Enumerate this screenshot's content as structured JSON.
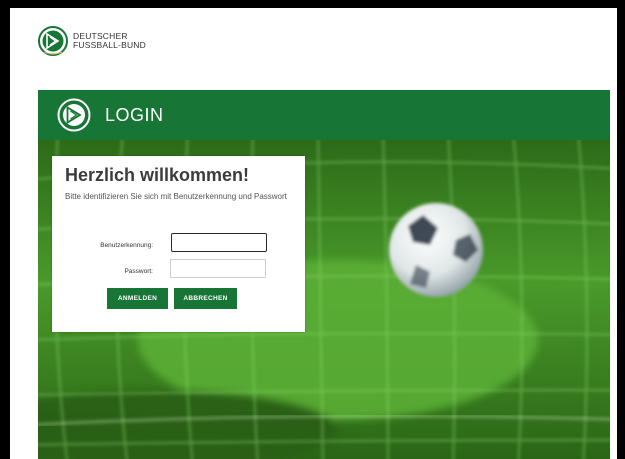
{
  "brand": {
    "line1": "DEUTSCHER",
    "line2": "FUSSBALL-BUND"
  },
  "login_bar": {
    "title": "LOGIN"
  },
  "card": {
    "title": "Herzlich willkommen!",
    "subtitle": "Bitte identifizieren Sie sich mit Benutzerkennung und Passwort"
  },
  "form": {
    "username_label": "Benutzerkennung:",
    "username_value": "",
    "password_label": "Passwort:",
    "password_value": ""
  },
  "buttons": {
    "login": "ANMELDEN",
    "cancel": "ABBRECHEN"
  },
  "colors": {
    "brand_green": "#177536",
    "hero_green": "#2d6f1a"
  }
}
